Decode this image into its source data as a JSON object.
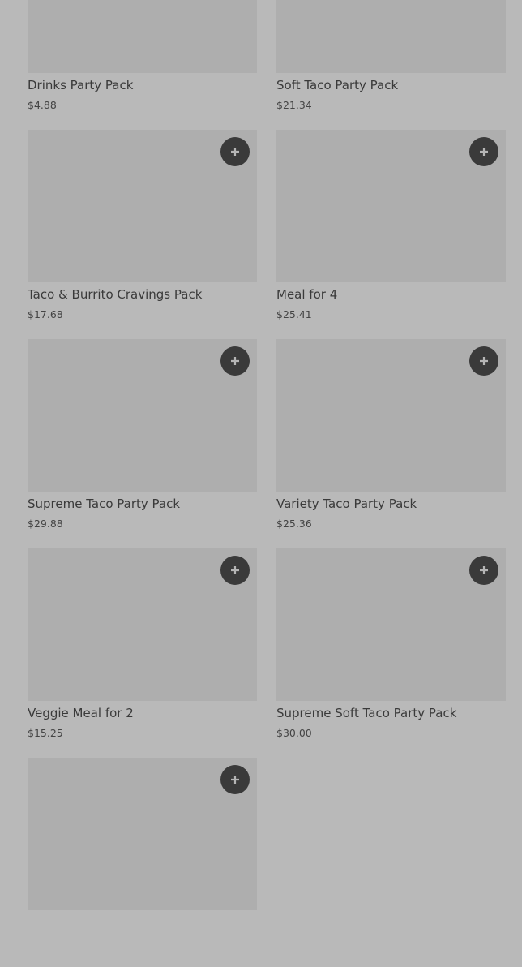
{
  "products": [
    {
      "name": "Drinks Party Pack",
      "price": "$4.88"
    },
    {
      "name": "Soft Taco Party Pack",
      "price": "$21.34"
    },
    {
      "name": "Taco & Burrito Cravings Pack",
      "price": "$17.68"
    },
    {
      "name": "Meal for 4",
      "price": "$25.41"
    },
    {
      "name": "Supreme Taco Party Pack",
      "price": "$29.88"
    },
    {
      "name": "Variety Taco Party Pack",
      "price": "$25.36"
    },
    {
      "name": "Veggie Meal for 2",
      "price": "$15.25"
    },
    {
      "name": "Supreme Soft Taco Party Pack",
      "price": "$30.00"
    },
    {
      "name": "",
      "price": ""
    }
  ],
  "icons": {
    "add": "plus-icon"
  },
  "colors": {
    "background": "#b9b9b9",
    "image_placeholder": "#aeaeae",
    "add_button": "#3a3a3a",
    "add_icon": "#b5b5b5",
    "text": "#3a3a3a"
  }
}
